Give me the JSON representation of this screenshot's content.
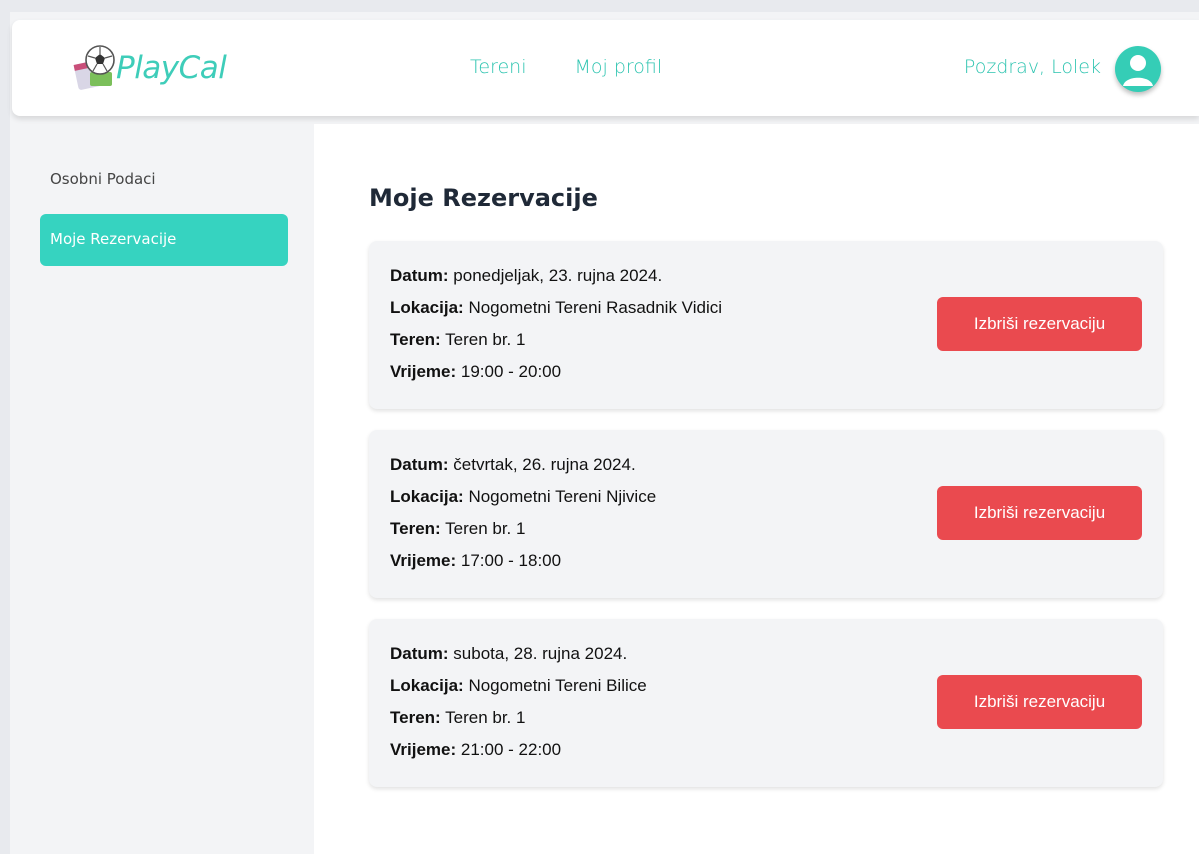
{
  "app": {
    "name": "PlayCal"
  },
  "nav": {
    "links": [
      "Tereni",
      "Moj profil"
    ],
    "greeting": "Pozdrav, Lolek"
  },
  "sidebar": {
    "items": [
      {
        "label": "Osobni Podaci",
        "active": false
      },
      {
        "label": "Moje Rezervacije",
        "active": true
      }
    ]
  },
  "main": {
    "title": "Moje Rezervacije",
    "field_labels": {
      "date": "Datum:",
      "location": "Lokacija:",
      "court": "Teren:",
      "time": "Vrijeme:"
    },
    "reservations": [
      {
        "date": "ponedjeljak, 23. rujna 2024.",
        "location": "Nogometni Tereni Rasadnik Vidici",
        "court": "Teren br. 1",
        "time": "19:00 - 20:00",
        "delete_label": "Izbriši rezervaciju"
      },
      {
        "date": "četvrtak, 26. rujna 2024.",
        "location": "Nogometni Tereni Njivice",
        "court": "Teren br. 1",
        "time": "17:00 - 18:00",
        "delete_label": "Izbriši rezervaciju"
      },
      {
        "date": "subota, 28. rujna 2024.",
        "location": "Nogometni Tereni Bilice",
        "court": "Teren br. 1",
        "time": "21:00 - 22:00",
        "delete_label": "Izbriši rezervaciju"
      }
    ]
  },
  "colors": {
    "accent": "#36d3c0",
    "nav_text": "#2ec4b0",
    "danger": "#ea4a4f",
    "card_bg": "#f3f4f6"
  }
}
